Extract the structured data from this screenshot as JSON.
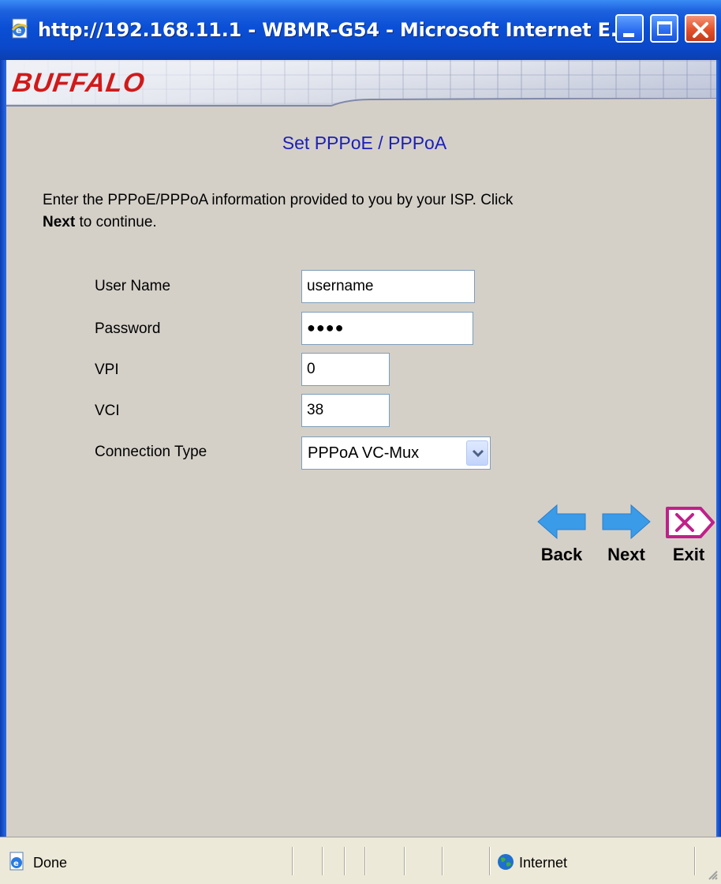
{
  "window": {
    "title": "http://192.168.11.1 - WBMR-G54 - Microsoft Internet E...",
    "title_icon": "ie-page-icon",
    "controls": [
      "minimize",
      "maximize",
      "close"
    ]
  },
  "header": {
    "logo": "BUFFALO",
    "logo_color": "#d01a1a"
  },
  "page": {
    "heading": "Set PPPoE / PPPoA",
    "heading_color": "#1c1fb8",
    "intro_before": "Enter the PPPoE/PPPoA information provided to you by your ISP. Click",
    "intro_bold": "Next",
    "intro_after": " to continue."
  },
  "form": {
    "username_label": "User Name",
    "username_value": "username",
    "password_label": "Password",
    "password_value": "●●●●",
    "vpi_label": "VPI",
    "vpi_value": "0",
    "vci_label": "VCI",
    "vci_value": "38",
    "conn_type_label": "Connection Type",
    "conn_type_value": "PPPoA VC-Mux"
  },
  "nav": {
    "back_label": "Back",
    "next_label": "Next",
    "exit_label": "Exit",
    "arrow_color": "#3a9be8",
    "exit_color": "#c0208a"
  },
  "statusbar": {
    "status": "Done",
    "zone": "Internet"
  }
}
